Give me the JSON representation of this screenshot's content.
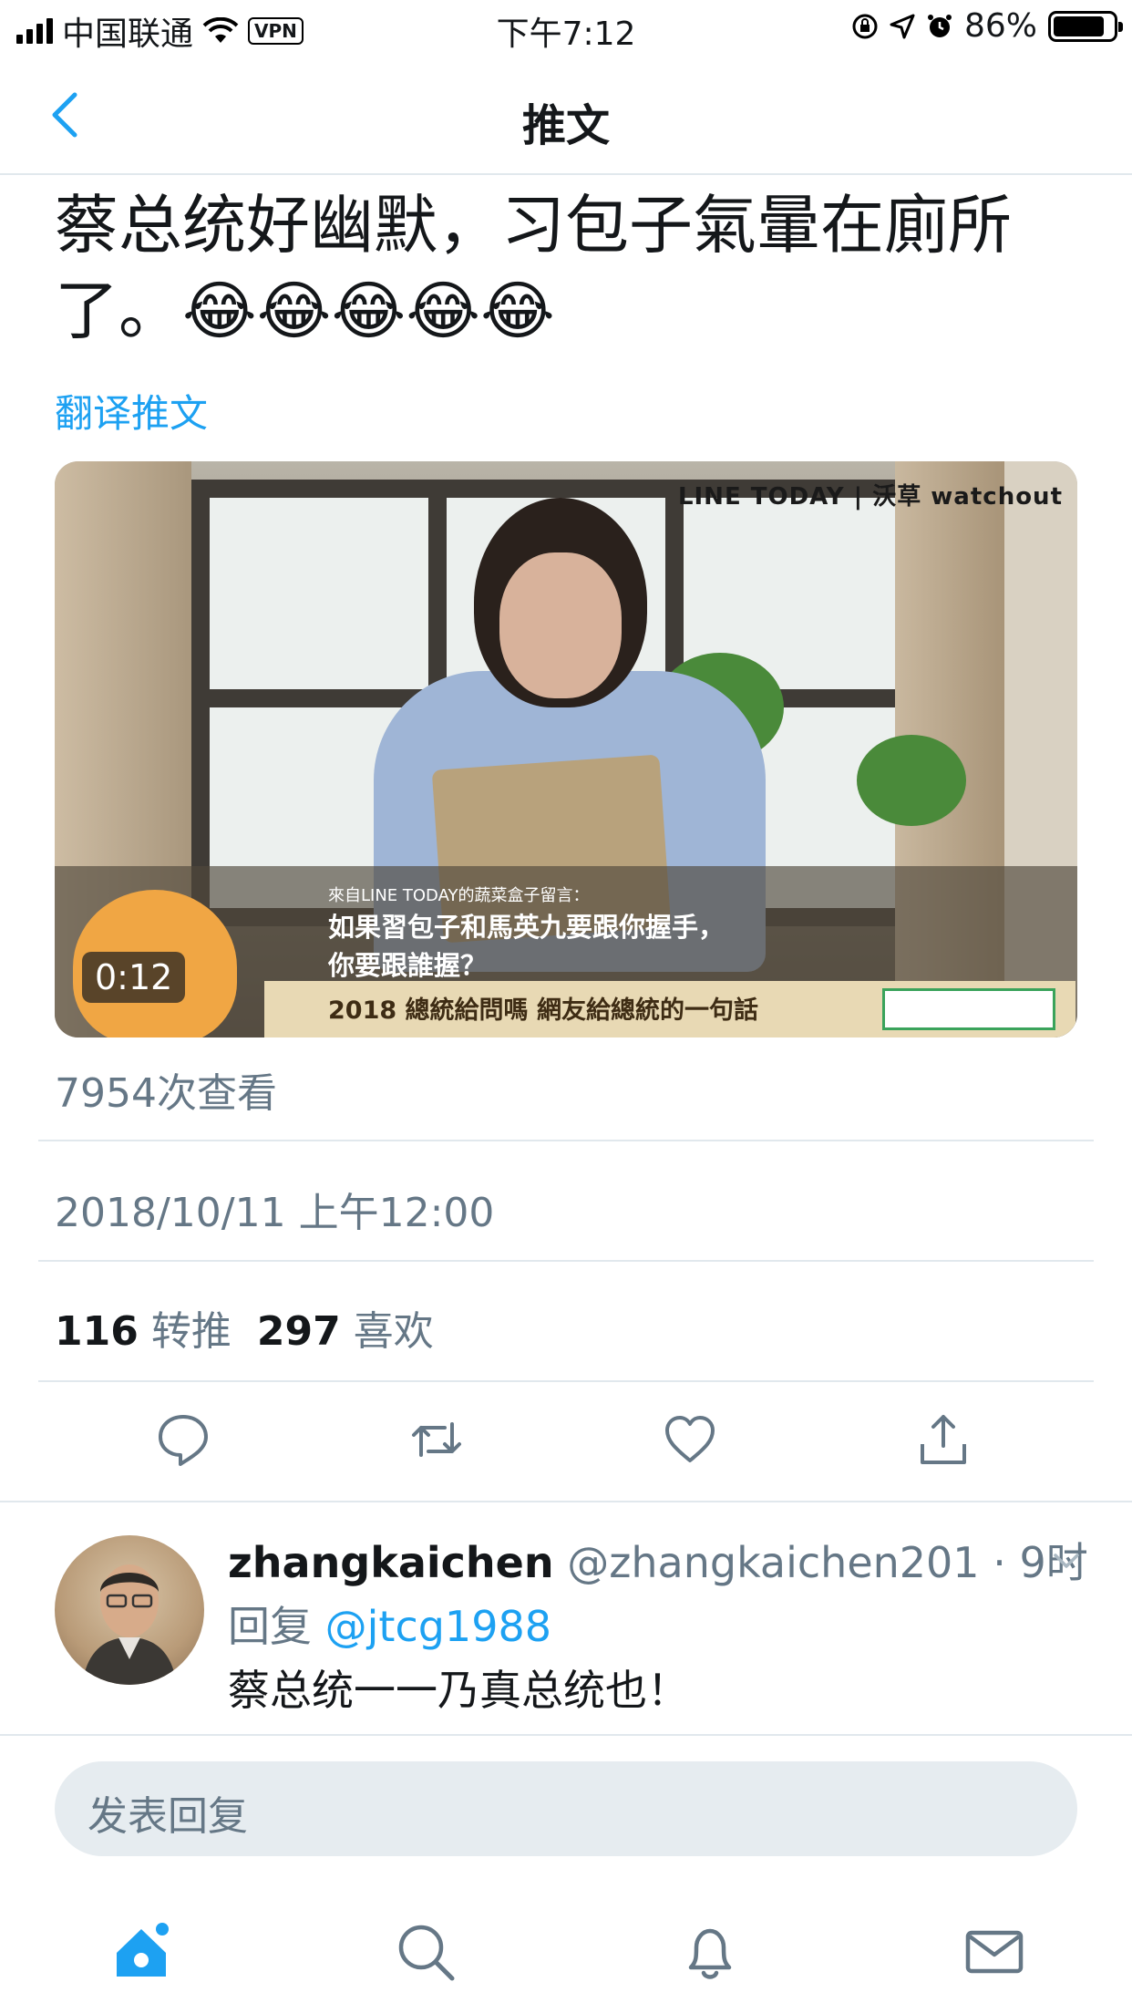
{
  "status_bar": {
    "carrier": "中国联通",
    "vpn": "VPN",
    "time": "下午7:12",
    "battery_pct": "86%",
    "battery_level": 0.86
  },
  "nav": {
    "title": "推文",
    "back_icon": "chevron-left-icon"
  },
  "tweet": {
    "text_line1": "蔡总统好幽默，习包子氣暈在廁所",
    "text_line2": "了。😂😂😂😂😂",
    "translate_link": "翻译推文",
    "video": {
      "overlay_logo": "LINE TODAY | 沃草 watchout",
      "caption_small": "來自LINE TODAY的蔬菜盒子留言：",
      "caption_line1": "如果習包子和馬英九要跟你握手，",
      "caption_line2": "你要跟誰握？",
      "caption_footer": "2018 總統給問嗎   網友給總統的一句話",
      "duration": "0:12"
    },
    "views": "7954次查看",
    "timestamp": "2018/10/11 上午12:00",
    "retweets_count": "116",
    "retweets_label": "转推",
    "likes_count": "297",
    "likes_label": "喜欢"
  },
  "actions": [
    "reply-icon",
    "retweet-icon",
    "like-icon",
    "share-icon"
  ],
  "reply": {
    "name": "zhangkaichen",
    "handle_time": "@zhangkaichen201 · 9时",
    "reply_prefix": "回复",
    "reply_to": "@jtcg1988",
    "text": "蔡总统一一乃真总统也！"
  },
  "compose": {
    "placeholder": "发表回复"
  },
  "tabbar": [
    "home-icon",
    "search-icon",
    "notifications-icon",
    "messages-icon"
  ],
  "colors": {
    "accent": "#1da1f2",
    "text": "#14171a",
    "secondary": "#657786",
    "divider": "#e1e8ed"
  }
}
